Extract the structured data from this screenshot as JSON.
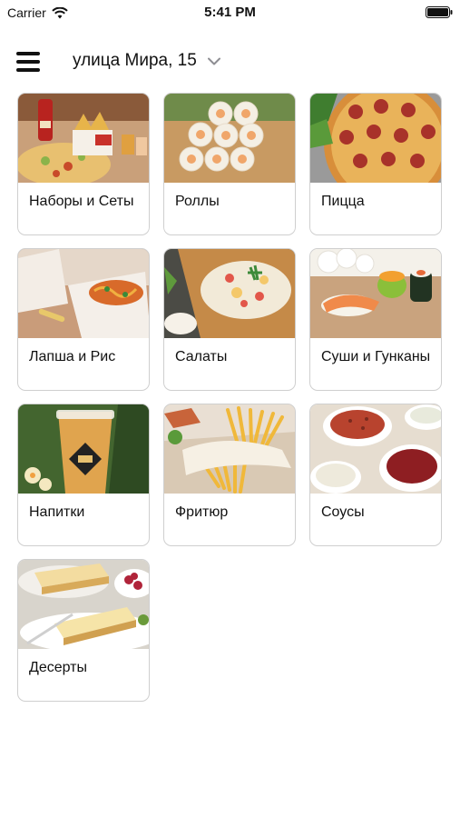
{
  "status_bar": {
    "carrier": "Carrier",
    "time": "5:41 PM"
  },
  "header": {
    "address": "улица Мира, 15"
  },
  "categories": [
    {
      "label": "Наборы и Сеты",
      "image": "sets-photo"
    },
    {
      "label": "Роллы",
      "image": "rolls-photo"
    },
    {
      "label": "Пицца",
      "image": "pizza-photo"
    },
    {
      "label": "Лапша и Рис",
      "image": "noodles-photo"
    },
    {
      "label": "Салаты",
      "image": "salad-photo"
    },
    {
      "label": "Суши и Гунканы",
      "image": "sushi-photo"
    },
    {
      "label": "Напитки",
      "image": "drinks-photo"
    },
    {
      "label": "Фритюр",
      "image": "fries-photo"
    },
    {
      "label": "Соусы",
      "image": "sauces-photo"
    },
    {
      "label": "Десерты",
      "image": "desserts-photo"
    }
  ],
  "icons": {
    "menu": "menu-icon",
    "chevron": "chevron-down-icon",
    "wifi": "wifi-icon",
    "battery": "battery-icon"
  }
}
